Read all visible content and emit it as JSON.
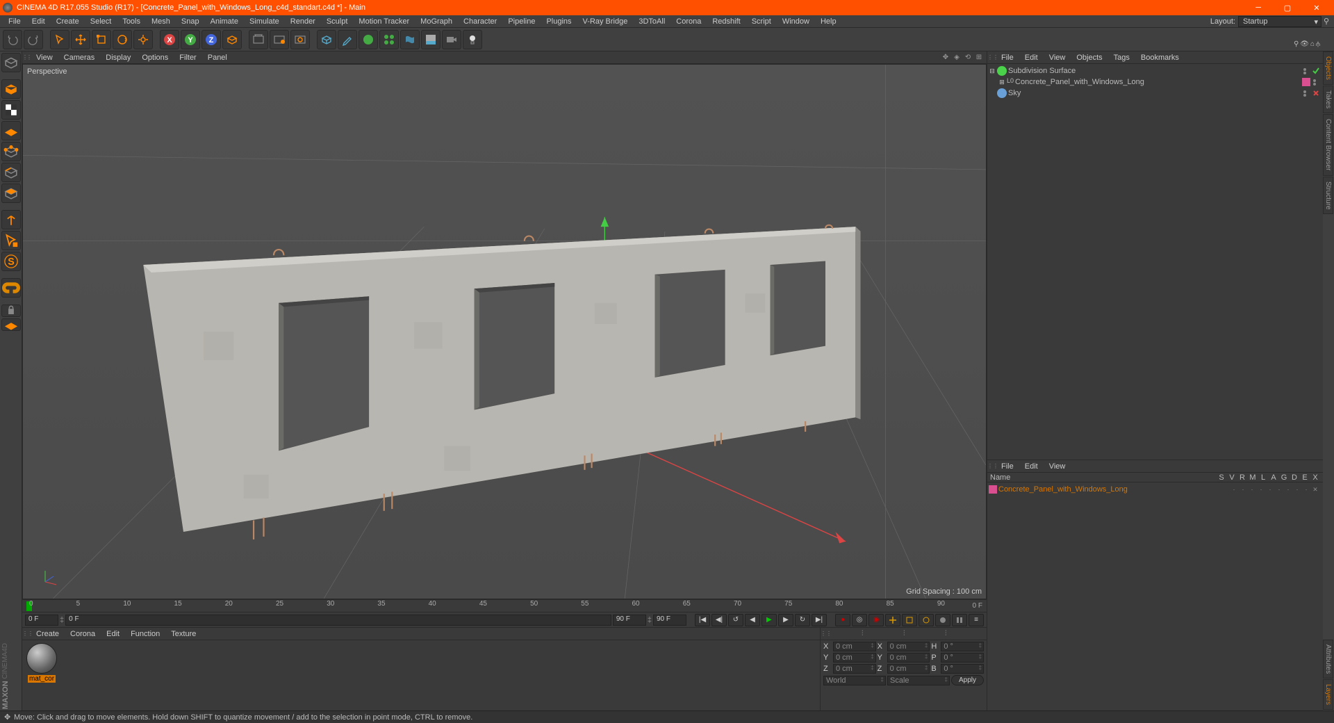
{
  "title": "CINEMA 4D R17.055 Studio (R17) - [Concrete_Panel_with_Windows_Long_c4d_standart.c4d *] - Main",
  "menus": [
    "File",
    "Edit",
    "Create",
    "Select",
    "Tools",
    "Mesh",
    "Snap",
    "Animate",
    "Simulate",
    "Render",
    "Sculpt",
    "Motion Tracker",
    "MoGraph",
    "Character",
    "Pipeline",
    "Plugins",
    "V-Ray Bridge",
    "3DToAll",
    "Corona",
    "Redshift",
    "Script",
    "Window",
    "Help"
  ],
  "layout_label": "Layout:",
  "layout_value": "Startup",
  "viewport_menus": [
    "View",
    "Cameras",
    "Display",
    "Options",
    "Filter",
    "Panel"
  ],
  "viewport_label": "Perspective",
  "grid_spacing": "Grid Spacing : 100 cm",
  "timeline": {
    "start": "0 F",
    "end": "90 F",
    "cur": "0 F",
    "range_end": "90 F",
    "ticks": [
      "0",
      "5",
      "10",
      "15",
      "20",
      "25",
      "30",
      "35",
      "40",
      "45",
      "50",
      "55",
      "60",
      "65",
      "70",
      "75",
      "80",
      "85",
      "90"
    ]
  },
  "material_menus": [
    "Create",
    "Corona",
    "Edit",
    "Function",
    "Texture"
  ],
  "material_name": "mat_cor",
  "coord": {
    "pos": {
      "X": "0 cm",
      "Y": "0 cm",
      "Z": "0 cm"
    },
    "size": {
      "X": "0 cm",
      "Y": "0 cm",
      "Z": "0 cm"
    },
    "rot": {
      "H": "0 °",
      "P": "0 °",
      "B": "0 °"
    },
    "space": "World",
    "size_mode": "Scale",
    "apply": "Apply"
  },
  "obj_menus": [
    "File",
    "Edit",
    "View",
    "Objects",
    "Tags",
    "Bookmarks"
  ],
  "objects": [
    {
      "name": "Subdivision Surface",
      "icon": "#4ad24a",
      "indent": 0,
      "exp": "⊟",
      "tags": [
        "vis",
        "check"
      ]
    },
    {
      "name": "Concrete_Panel_with_Windows_Long",
      "icon": "#bbb",
      "indent": 1,
      "exp": "⊞",
      "tags": [
        "layer",
        "vis"
      ],
      "null": true
    },
    {
      "name": "Sky",
      "icon": "#6aa0d8",
      "indent": 0,
      "exp": "",
      "tags": [
        "vis",
        "x"
      ]
    }
  ],
  "layer_menus": [
    "File",
    "Edit",
    "View"
  ],
  "layer_name_hdr": "Name",
  "layer_cols": [
    "S",
    "V",
    "R",
    "M",
    "L",
    "A",
    "G",
    "D",
    "E",
    "X"
  ],
  "layers": [
    {
      "name": "Concrete_Panel_with_Windows_Long",
      "color": "#d94f8f"
    }
  ],
  "side_tabs_top": [
    "Objects",
    "Takes",
    "Content Browser",
    "Structure"
  ],
  "side_tabs_bot": [
    "Attributes",
    "Layers"
  ],
  "status": "Move: Click and drag to move elements. Hold down SHIFT to quantize movement / add to the selection in point mode, CTRL to remove.",
  "maxon": "MAXON CINEMA4D"
}
